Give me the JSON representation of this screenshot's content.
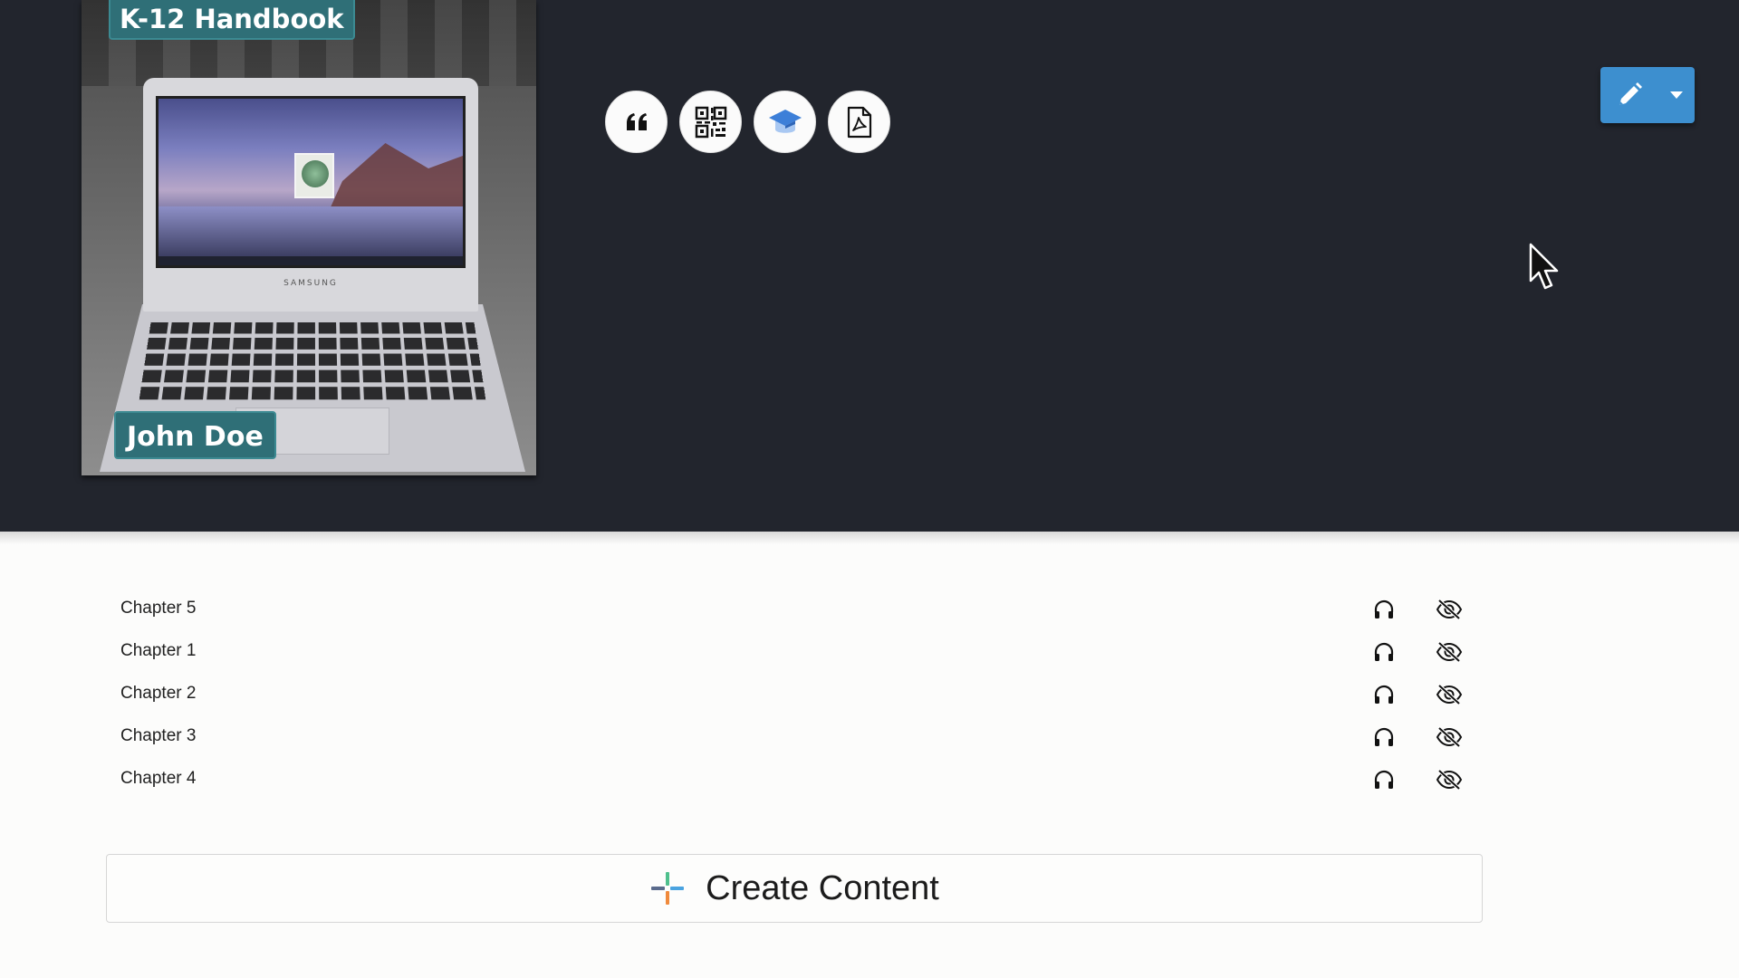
{
  "book": {
    "title_badge": "K-12 Handbook",
    "author_badge": "John Doe",
    "cover_brand_text": "SAMSUNG"
  },
  "toolbar": {
    "tools": [
      {
        "icon": "quote-icon",
        "name": "citation"
      },
      {
        "icon": "qr-code-icon",
        "name": "qr-code"
      },
      {
        "icon": "graduation-cap-icon",
        "name": "classroom"
      },
      {
        "icon": "pdf-file-icon",
        "name": "pdf"
      }
    ],
    "edit_icon": "pencil-icon",
    "edit_dropdown_icon": "caret-down-icon",
    "accent_color": "#3d8fcf"
  },
  "chapters": [
    {
      "label": "Chapter 5",
      "audio_icon": "headphones-icon",
      "visibility_icon": "eye-slash-icon"
    },
    {
      "label": "Chapter 1",
      "audio_icon": "headphones-icon",
      "visibility_icon": "eye-slash-icon"
    },
    {
      "label": "Chapter 2",
      "audio_icon": "headphones-icon",
      "visibility_icon": "eye-slash-icon"
    },
    {
      "label": "Chapter 3",
      "audio_icon": "headphones-icon",
      "visibility_icon": "eye-slash-icon"
    },
    {
      "label": "Chapter 4",
      "audio_icon": "headphones-icon",
      "visibility_icon": "eye-slash-icon"
    }
  ],
  "create": {
    "label": "Create Content",
    "icon": "colorful-plus-icon"
  },
  "colors": {
    "header_bg": "#22252d",
    "badge_bg": "#2f6f77",
    "page_bg": "#fcfcfb"
  }
}
